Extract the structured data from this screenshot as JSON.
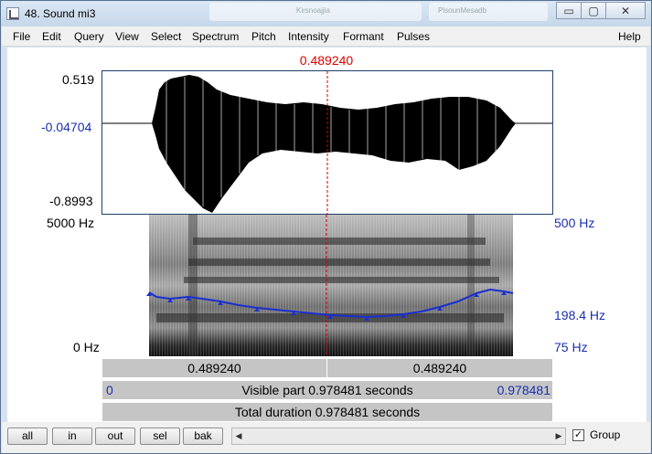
{
  "window": {
    "title": "48. Sound mi3",
    "background_ghost_label": "Kirsnoajjia",
    "background_ghost_label2": "PlsounMesadb",
    "minimize": "▭",
    "maximize": "▢",
    "close": "✕"
  },
  "menu": {
    "items": [
      {
        "label": "File"
      },
      {
        "label": "Edit"
      },
      {
        "label": "Query"
      },
      {
        "label": "View"
      },
      {
        "label": "Select"
      },
      {
        "label": "Spectrum"
      },
      {
        "label": "Pitch"
      },
      {
        "label": "Intensity"
      },
      {
        "label": "Formant"
      },
      {
        "label": "Pulses"
      }
    ],
    "help": "Help"
  },
  "editor": {
    "cursor_time": "0.489240",
    "waveform": {
      "max_label": "0.519",
      "cursor_value_label": "-0.04704",
      "min_label": "-0.8993"
    },
    "spectrogram": {
      "top_freq_label": "5000 Hz",
      "bottom_freq_label": "0 Hz",
      "pitch_top_label": "500 Hz",
      "pitch_value_label": "198.4 Hz",
      "pitch_bottom_label": "75 Hz",
      "colors": {
        "pitch": "#1a2fd0",
        "cursor": "#d00000"
      }
    },
    "time_bars": {
      "left_segment": "0.489240",
      "right_segment": "0.489240",
      "visible_start": "0",
      "visible_label": "Visible part 0.978481 seconds",
      "visible_end": "0.978481",
      "total_label": "Total duration 0.978481 seconds"
    }
  },
  "bottom": {
    "buttons": [
      {
        "label": "all"
      },
      {
        "label": "in"
      },
      {
        "label": "out"
      },
      {
        "label": "sel"
      },
      {
        "label": "bak"
      }
    ],
    "scroll_left": "◀",
    "scroll_right": "▶",
    "group_checked": "✓",
    "group_label": "Group"
  }
}
